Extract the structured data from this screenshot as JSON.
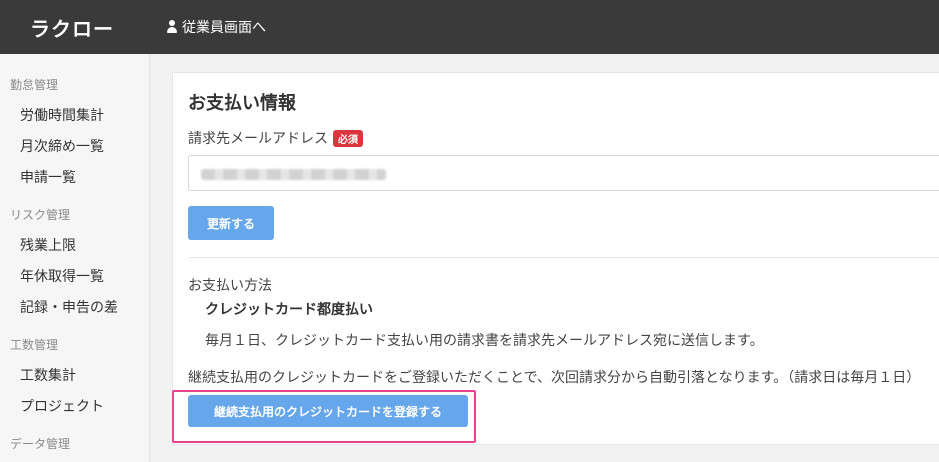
{
  "header": {
    "logo": "ラクロー",
    "employee_link": "従業員画面へ"
  },
  "sidebar": {
    "sections": [
      {
        "title": "勤怠管理",
        "items": [
          "労働時間集計",
          "月次締め一覧",
          "申請一覧"
        ]
      },
      {
        "title": "リスク管理",
        "items": [
          "残業上限",
          "年休取得一覧",
          "記録・申告の差"
        ]
      },
      {
        "title": "工数管理",
        "items": [
          "工数集計",
          "プロジェクト"
        ]
      },
      {
        "title": "データ管理",
        "items": []
      }
    ]
  },
  "main": {
    "title": "お支払い情報",
    "email_label": "請求先メールアドレス",
    "required_badge": "必須",
    "update_button": "更新する",
    "payment_method_label": "お支払い方法",
    "payment_method": "クレジットカード都度払い",
    "payment_description": "毎月１日、クレジットカード支払い用の請求書を請求先メールアドレス宛に送信します。",
    "note": "継続支払用のクレジットカードをご登録いただくことで、次回請求分から自動引落となります。（請求日は毎月１日）",
    "register_button": "継続支払用のクレジットカードを登録する"
  },
  "colors": {
    "header_bg": "#3a3a3a",
    "button_blue": "#66a6ea",
    "required_red": "#d9363e",
    "highlight_pink": "#e8418d"
  }
}
